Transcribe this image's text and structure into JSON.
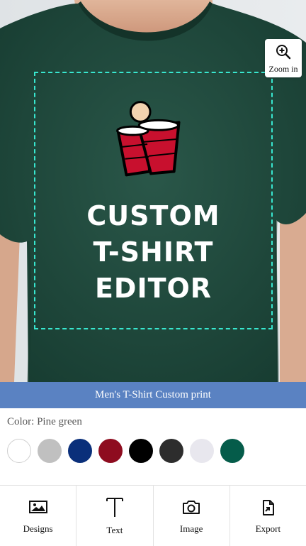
{
  "preview": {
    "zoom_label": "Zoom in",
    "design_lines": [
      "CUSTOM",
      "T-SHIRT",
      "EDITOR"
    ],
    "print_area_color": "#38e7cf"
  },
  "product": {
    "title": "Men's T-Shirt Custom print"
  },
  "color": {
    "label": "Color: Pine green",
    "selected": "Pine green",
    "swatches": [
      "#ffffff",
      "#c0c0c0",
      "#0a2f7a",
      "#8e0c1f",
      "#000000",
      "#2d2d2d",
      "#e8e7ee",
      "#055c4a"
    ]
  },
  "toolbar": {
    "items": [
      {
        "label": "Designs",
        "icon": "image-icon"
      },
      {
        "label": "Text",
        "icon": "text-icon"
      },
      {
        "label": "Image",
        "icon": "camera-icon"
      },
      {
        "label": "Export",
        "icon": "export-icon"
      }
    ]
  },
  "colors": {
    "title_bar": "#5a82c2",
    "shirt": "#1f4a3c"
  }
}
